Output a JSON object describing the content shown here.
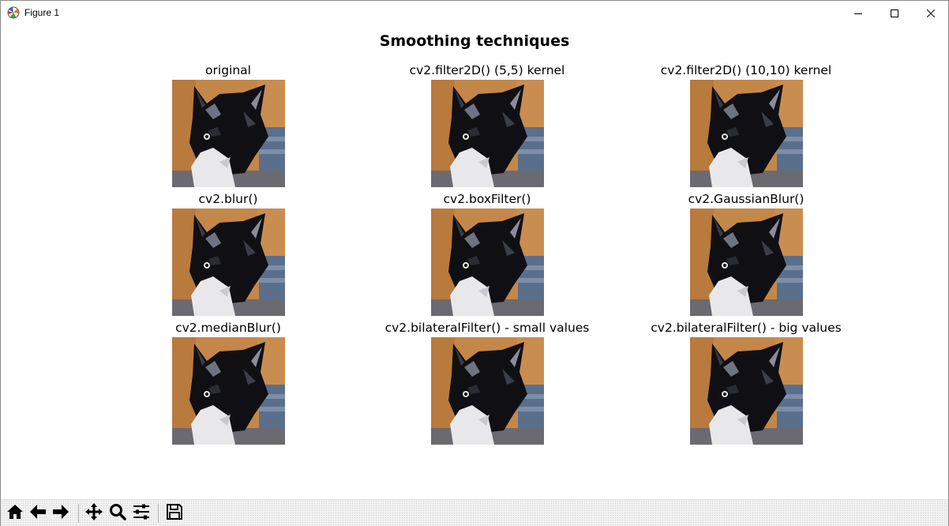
{
  "window": {
    "title": "Figure 1",
    "icons": {
      "app": "matplotlib-icon",
      "minimize": "minimize-icon",
      "maximize": "maximize-icon",
      "close": "close-icon"
    }
  },
  "figure": {
    "suptitle": "Smoothing techniques",
    "panels": [
      {
        "title": "original",
        "image": "cat-kitten-photo-original"
      },
      {
        "title": "cv2.filter2D() (5,5) kernel",
        "image": "cat-kitten-photo-filter2d-5"
      },
      {
        "title": "cv2.filter2D() (10,10) kernel",
        "image": "cat-kitten-photo-filter2d-10"
      },
      {
        "title": "cv2.blur()",
        "image": "cat-kitten-photo-blur"
      },
      {
        "title": "cv2.boxFilter()",
        "image": "cat-kitten-photo-boxfilter"
      },
      {
        "title": "cv2.GaussianBlur()",
        "image": "cat-kitten-photo-gaussian"
      },
      {
        "title": "cv2.medianBlur()",
        "image": "cat-kitten-photo-median"
      },
      {
        "title": "cv2.bilateralFilter() - small values",
        "image": "cat-kitten-photo-bilateral-small"
      },
      {
        "title": "cv2.bilateralFilter() - big values",
        "image": "cat-kitten-photo-bilateral-big"
      }
    ]
  },
  "toolbar": {
    "buttons": [
      {
        "name": "home-button",
        "icon": "home-icon"
      },
      {
        "name": "back-button",
        "icon": "arrow-left-icon"
      },
      {
        "name": "forward-button",
        "icon": "arrow-right-icon"
      },
      {
        "name": "pan-button",
        "icon": "move-icon"
      },
      {
        "name": "zoom-button",
        "icon": "magnifier-icon"
      },
      {
        "name": "subplots-button",
        "icon": "sliders-icon"
      },
      {
        "name": "save-button",
        "icon": "floppy-disk-icon"
      }
    ]
  },
  "colors": {
    "fur_black": "#101014",
    "fur_white": "#e8e8ea",
    "background_wood": "#c4874a",
    "background_blue": "#5a6f8c",
    "toolbar_bg": "#f0f0f0"
  }
}
